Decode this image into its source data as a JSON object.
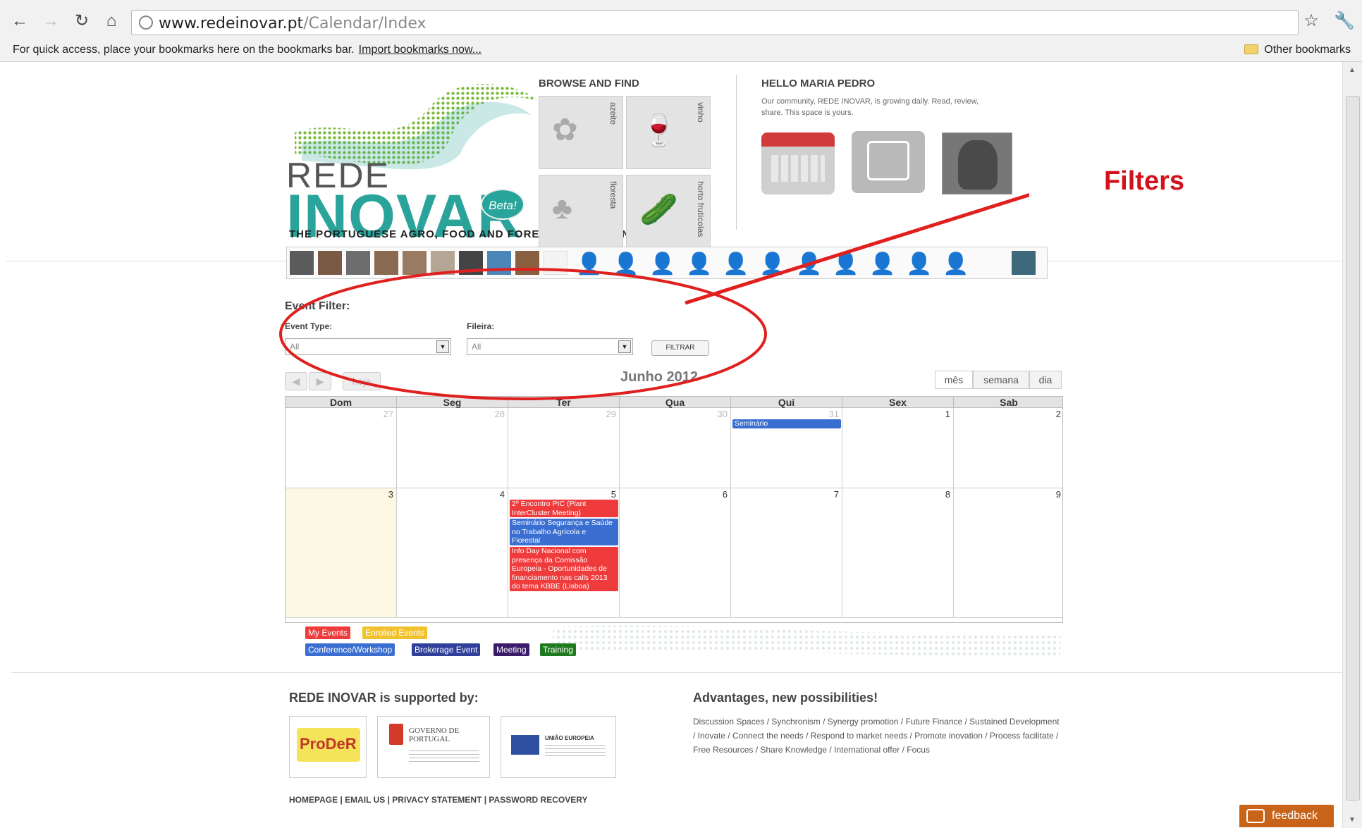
{
  "browser": {
    "url_host": "www.redeinovar.pt",
    "url_path": "/Calendar/Index",
    "bookmarks_message": "For quick access, place your bookmarks here on the bookmarks bar.",
    "import_link": "Import bookmarks now...",
    "other_bookmarks": "Other bookmarks"
  },
  "header": {
    "logo_rede": "REDE",
    "logo_inovar": "INOVAR",
    "beta": "Beta!",
    "tagline": "THE PORTUGUESE AGRO, FOOD AND FOREST INNOVATION NETWORK",
    "browse_title": "BROWSE AND FIND",
    "browse_tiles": [
      "azeite",
      "vinho",
      "floresta",
      "horto frutícolas"
    ],
    "hello_title": "HELLO MARIA PEDRO",
    "hello_text": "Our community, REDE INOVAR, is growing daily. Read, review, share. This space is yours."
  },
  "filter": {
    "title": "Event Filter:",
    "event_type_label": "Event Type:",
    "fileira_label": "Fileira:",
    "event_type_value": "All",
    "fileira_value": "All",
    "button": "FILTRAR"
  },
  "calendar": {
    "today_button": "hoje",
    "month_title": "Junho 2012",
    "views": [
      "mês",
      "semana",
      "dia"
    ],
    "weekdays": [
      "Dom",
      "Seg",
      "Ter",
      "Qua",
      "Qui",
      "Sex",
      "Sab"
    ],
    "week1": [
      "27",
      "28",
      "29",
      "30",
      "31",
      "1",
      "2"
    ],
    "week2": [
      "3",
      "4",
      "5",
      "6",
      "7",
      "8",
      "9"
    ],
    "events": {
      "seminario": "Seminário",
      "encontro": "2º Encontro PIC (Plant InterCluster Meeting)",
      "seguranca": "Seminário Segurança e Saúde no Trabalho Agrícola e Florestal",
      "infoday": "Info Day Nacional com presença da Comissão Europeia - Oportunidades de financiamento nas calls 2013 do tema KBBE (Lisboa)"
    }
  },
  "legend": [
    {
      "label": "My Events",
      "color": "#ef3b3b"
    },
    {
      "label": "Enrolled Events",
      "color": "#f2c12e"
    },
    {
      "label": "Conference/Workshop",
      "color": "#3a6fd1"
    },
    {
      "label": "Brokerage Event",
      "color": "#2f3f9a"
    },
    {
      "label": "Meeting",
      "color": "#3b1a6b"
    },
    {
      "label": "Training",
      "color": "#1f7a1f"
    }
  ],
  "footer": {
    "supported_title": "REDE INOVAR is supported by:",
    "advantages_title": "Advantages, new possibilities!",
    "advantages_text": "Discussion Spaces / Synchronism / Synergy promotion / Future Finance / Sustained Development / Inovate / Connect the needs / Respond to market needs / Promote inovation / Process facilitate / Free Resources / Share Knowledge / International offer / Focus",
    "links": "HOMEPAGE | EMAIL US | PRIVACY STATEMENT | PASSWORD RECOVERY",
    "sponsors": [
      "ProDeR",
      "GOVERNO DE PORTUGAL",
      "UNIÃO EUROPEIA"
    ],
    "feedback": "feedback"
  },
  "annotation": {
    "label": "Filters",
    "color": "#d3111a"
  }
}
